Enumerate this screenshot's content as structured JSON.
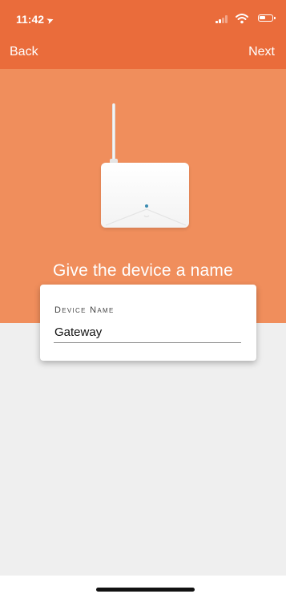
{
  "status_bar": {
    "time": "11:42",
    "location_icon": "location-arrow-icon",
    "battery_level": 0.55,
    "signal_bars": 2
  },
  "nav": {
    "back_label": "Back",
    "next_label": "Next"
  },
  "hero": {
    "title": "Give the device a name",
    "image_icon": "router-device-image"
  },
  "form": {
    "label": "Device Name",
    "value": "Gateway"
  },
  "colors": {
    "header": "#ea6c3b",
    "hero": "#f08e5c",
    "background": "#efefef"
  }
}
